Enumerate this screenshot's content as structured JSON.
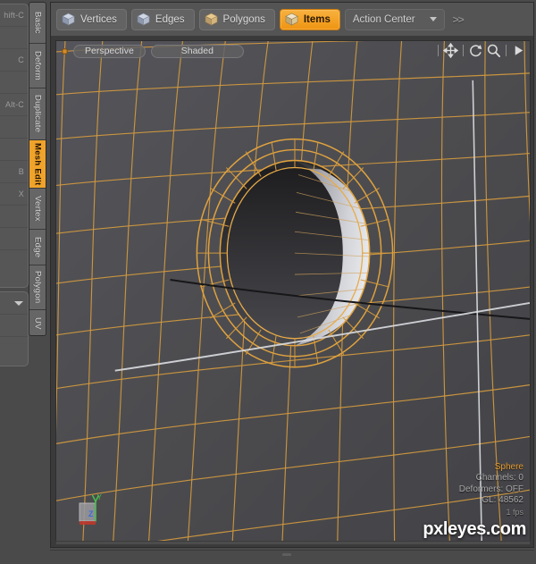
{
  "app": {
    "accent_orange": "#f0a32a",
    "viewport_bg": "#4e4e51",
    "wire_color": "#d59a3c",
    "panel_bg": "#4a4a4a"
  },
  "left_tool_column": {
    "groups": [
      {
        "rows": [
          {
            "shortcut": "hift-C"
          },
          {
            "shortcut": ""
          },
          {
            "shortcut": "C"
          },
          {
            "shortcut": ""
          },
          {
            "shortcut": "Alt-C"
          },
          {
            "shortcut": ""
          },
          {
            "shortcut": ""
          },
          {
            "shortcut": "B"
          },
          {
            "shortcut": "X"
          },
          {
            "shortcut": ""
          },
          {
            "shortcut": ""
          },
          {
            "shortcut": ""
          }
        ]
      },
      {
        "rows": [
          {
            "shortcut": ""
          },
          {
            "shortcut": ""
          },
          {
            "shortcut": ""
          }
        ]
      }
    ]
  },
  "vertical_tabs": {
    "items": [
      {
        "label": "Basic",
        "active": false
      },
      {
        "label": "Deform",
        "active": false
      },
      {
        "label": "Duplicate",
        "active": false
      },
      {
        "label": "Mesh Edit",
        "active": true
      },
      {
        "label": "Vertex",
        "active": false
      },
      {
        "label": "Edge",
        "active": false
      },
      {
        "label": "Polygon",
        "active": false
      },
      {
        "label": "UV",
        "active": false
      }
    ]
  },
  "toolbar": {
    "vertices_label": "Vertices",
    "edges_label": "Edges",
    "polygons_label": "Polygons",
    "items_label": "Items",
    "action_center_label": "Action Center",
    "overflow_label": ">>"
  },
  "viewport_header": {
    "projection_label": "Perspective",
    "shading_label": "Shaded",
    "tools": [
      {
        "icon": "move-icon"
      },
      {
        "icon": "rotate-icon"
      },
      {
        "icon": "zoom-icon"
      },
      {
        "icon": "play-icon"
      }
    ]
  },
  "hud": {
    "object_name": "Sphere",
    "channels": "Channels: 0",
    "deformers": "Deformers: OFF",
    "gl": "GL: 48562",
    "fps": "1 fps"
  },
  "gizmo": {
    "y_label": "Y",
    "z_label": "Z"
  },
  "watermark": {
    "text": "pxleyes.com"
  }
}
